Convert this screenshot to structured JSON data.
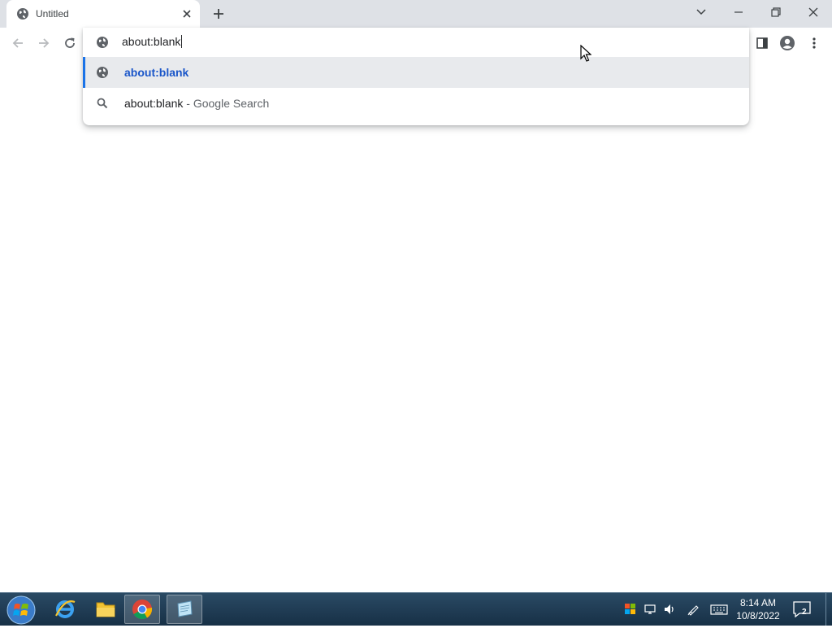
{
  "browser": {
    "tab": {
      "title": "Untitled",
      "favicon": "globe-icon",
      "close_icon": "close-icon"
    },
    "new_tab_icon": "plus-icon",
    "window_controls": [
      "tab-search-icon",
      "minimize-icon",
      "restore-icon",
      "close-icon"
    ],
    "nav": [
      "back-icon",
      "forward-icon",
      "reload-icon"
    ],
    "omnibox": {
      "value": "about:blank",
      "suggestions": [
        {
          "text": "about:blank",
          "suffix": "",
          "icon": "globe-icon",
          "selected": true
        },
        {
          "text": "about:blank",
          "suffix": " - Google Search",
          "icon": "search-icon",
          "selected": false
        }
      ]
    },
    "right_toolbar": [
      "side-panel-icon",
      "profile-icon",
      "menu-icon"
    ]
  },
  "taskbar": {
    "apps": [
      "internet-explorer-icon",
      "file-explorer-icon",
      "chrome-icon",
      "notepad-icon"
    ],
    "tray": [
      "shield-icon",
      "network-icon",
      "volume-icon",
      "pen-icon",
      "keyboard-icon"
    ],
    "clock": {
      "time": "8:14 AM",
      "date": "10/8/2022"
    },
    "notifications": {
      "count": "2"
    }
  },
  "colors": {
    "titlebar": "#dee1e6",
    "accent": "#1a73e8",
    "taskbar": "#1f3a52"
  }
}
